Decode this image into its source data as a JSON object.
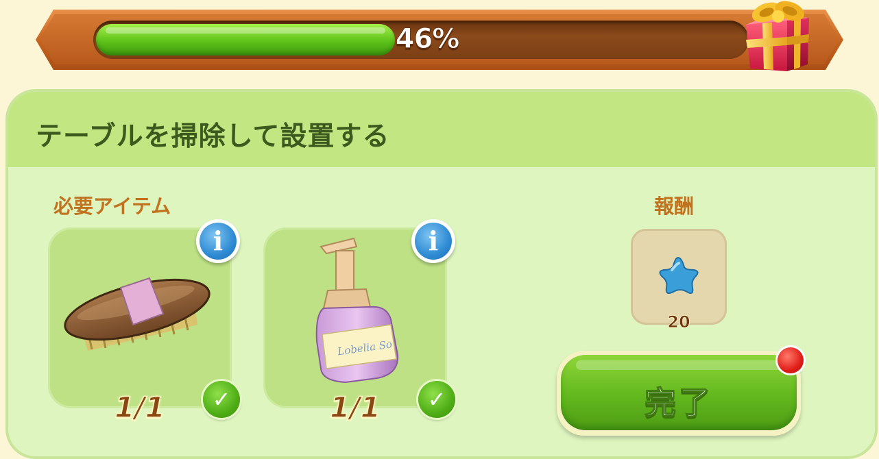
{
  "progress": {
    "percent_label": "46%",
    "fraction": 0.46
  },
  "quest": {
    "title": "テーブルを掃除して設置する"
  },
  "required_items": {
    "label": "必要アイテム",
    "items": [
      {
        "name": "brush",
        "icon": "brush-icon",
        "count": "1/1",
        "complete": true
      },
      {
        "name": "soap-bottle",
        "icon": "soap-bottle-icon",
        "count": "1/1",
        "complete": true
      }
    ]
  },
  "reward": {
    "label": "報酬",
    "icon": "blue-star-icon",
    "amount": "20"
  },
  "complete_button": {
    "label": "完了"
  },
  "colors": {
    "progress_fill": "#5ec21a",
    "panel_bg": "#def5bf",
    "header_bg": "#c2e682",
    "label_orange": "#c0721f",
    "title_green": "#3d5a1e",
    "star_blue": "#3a9fd8"
  }
}
